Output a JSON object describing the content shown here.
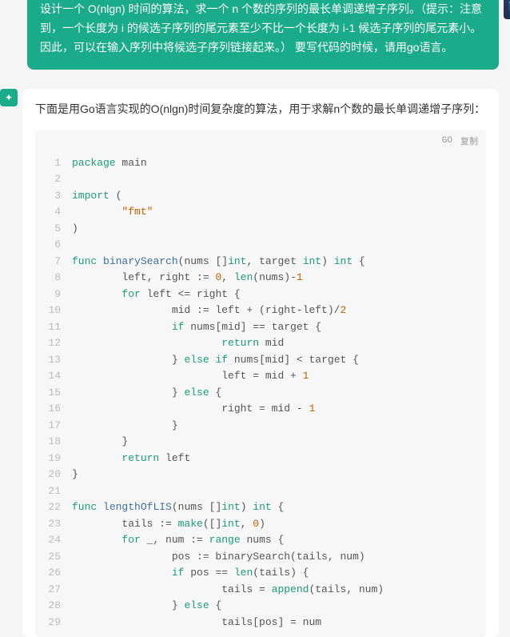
{
  "user_message": "设计一个 O(nlgn) 时间的算法，求一个 n 个数的序列的最长单调递增子序列。（提示：注意到，一个长度为 i 的候选子序列的尾元素至少不比一个长度为 i-1 候选子序列的尾元素小。因此，可以在输入序列中将候选子序列链接起来。） 要写代码的时候，请用go语言。",
  "user_avatar_emoji": "🌃",
  "assistant_avatar_glyph": "✦",
  "assistant_intro": "下面是用Go语言实现的O(nlgn)时间复杂度的算法，用于求解n个数的最长单调递增子序列：",
  "code_lang": "GO",
  "copy_label": "复制",
  "code_lines": [
    [
      {
        "t": "package",
        "c": "kw"
      },
      {
        "t": " main",
        "c": ""
      }
    ],
    [],
    [
      {
        "t": "import",
        "c": "kw"
      },
      {
        "t": " (",
        "c": ""
      }
    ],
    [
      {
        "t": "        ",
        "c": ""
      },
      {
        "t": "\"fmt\"",
        "c": "str"
      }
    ],
    [
      {
        "t": ")",
        "c": ""
      }
    ],
    [],
    [
      {
        "t": "func",
        "c": "kw"
      },
      {
        "t": " ",
        "c": ""
      },
      {
        "t": "binarySearch",
        "c": "fn"
      },
      {
        "t": "(nums []",
        "c": ""
      },
      {
        "t": "int",
        "c": "type"
      },
      {
        "t": ", target ",
        "c": ""
      },
      {
        "t": "int",
        "c": "type"
      },
      {
        "t": ") ",
        "c": ""
      },
      {
        "t": "int",
        "c": "type"
      },
      {
        "t": " {",
        "c": ""
      }
    ],
    [
      {
        "t": "        left, right := ",
        "c": ""
      },
      {
        "t": "0",
        "c": "num"
      },
      {
        "t": ", ",
        "c": ""
      },
      {
        "t": "len",
        "c": "kw"
      },
      {
        "t": "(nums)-",
        "c": ""
      },
      {
        "t": "1",
        "c": "num"
      }
    ],
    [
      {
        "t": "        ",
        "c": ""
      },
      {
        "t": "for",
        "c": "kw"
      },
      {
        "t": " left <= right {",
        "c": ""
      }
    ],
    [
      {
        "t": "                mid := left + (right-left)/",
        "c": ""
      },
      {
        "t": "2",
        "c": "num"
      }
    ],
    [
      {
        "t": "                ",
        "c": ""
      },
      {
        "t": "if",
        "c": "kw"
      },
      {
        "t": " nums[mid] == target {",
        "c": ""
      }
    ],
    [
      {
        "t": "                        ",
        "c": ""
      },
      {
        "t": "return",
        "c": "kw"
      },
      {
        "t": " mid",
        "c": ""
      }
    ],
    [
      {
        "t": "                } ",
        "c": ""
      },
      {
        "t": "else",
        "c": "kw"
      },
      {
        "t": " ",
        "c": ""
      },
      {
        "t": "if",
        "c": "kw"
      },
      {
        "t": " nums[mid] < target {",
        "c": ""
      }
    ],
    [
      {
        "t": "                        left = mid + ",
        "c": ""
      },
      {
        "t": "1",
        "c": "num"
      }
    ],
    [
      {
        "t": "                } ",
        "c": ""
      },
      {
        "t": "else",
        "c": "kw"
      },
      {
        "t": " {",
        "c": ""
      }
    ],
    [
      {
        "t": "                        right = mid - ",
        "c": ""
      },
      {
        "t": "1",
        "c": "num"
      }
    ],
    [
      {
        "t": "                }",
        "c": ""
      }
    ],
    [
      {
        "t": "        }",
        "c": ""
      }
    ],
    [
      {
        "t": "        ",
        "c": ""
      },
      {
        "t": "return",
        "c": "kw"
      },
      {
        "t": " left",
        "c": ""
      }
    ],
    [
      {
        "t": "}",
        "c": ""
      }
    ],
    [],
    [
      {
        "t": "func",
        "c": "kw"
      },
      {
        "t": " ",
        "c": ""
      },
      {
        "t": "lengthOfLIS",
        "c": "fn"
      },
      {
        "t": "(nums []",
        "c": ""
      },
      {
        "t": "int",
        "c": "type"
      },
      {
        "t": ") ",
        "c": ""
      },
      {
        "t": "int",
        "c": "type"
      },
      {
        "t": " {",
        "c": ""
      }
    ],
    [
      {
        "t": "        tails := ",
        "c": ""
      },
      {
        "t": "make",
        "c": "kw"
      },
      {
        "t": "([]",
        "c": ""
      },
      {
        "t": "int",
        "c": "type"
      },
      {
        "t": ", ",
        "c": ""
      },
      {
        "t": "0",
        "c": "num"
      },
      {
        "t": ")",
        "c": ""
      }
    ],
    [
      {
        "t": "        ",
        "c": ""
      },
      {
        "t": "for",
        "c": "kw"
      },
      {
        "t": " _, num := ",
        "c": ""
      },
      {
        "t": "range",
        "c": "kw"
      },
      {
        "t": " nums {",
        "c": ""
      }
    ],
    [
      {
        "t": "                pos := binarySearch(tails, num)",
        "c": ""
      }
    ],
    [
      {
        "t": "                ",
        "c": ""
      },
      {
        "t": "if",
        "c": "kw"
      },
      {
        "t": " pos == ",
        "c": ""
      },
      {
        "t": "len",
        "c": "kw"
      },
      {
        "t": "(tails) {",
        "c": ""
      }
    ],
    [
      {
        "t": "                        tails = ",
        "c": ""
      },
      {
        "t": "append",
        "c": "kw"
      },
      {
        "t": "(tails, num)",
        "c": ""
      }
    ],
    [
      {
        "t": "                } ",
        "c": ""
      },
      {
        "t": "else",
        "c": "kw"
      },
      {
        "t": " {",
        "c": ""
      }
    ],
    [
      {
        "t": "                        tails[pos] = num",
        "c": ""
      }
    ]
  ]
}
